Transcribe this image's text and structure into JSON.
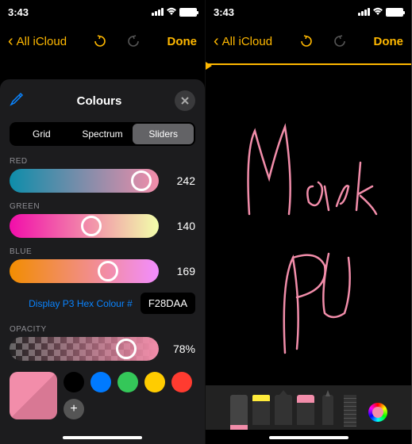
{
  "time": "3:43",
  "nav": {
    "back": "All iCloud",
    "done": "Done"
  },
  "panel": {
    "title": "Colours",
    "tabs": {
      "grid": "Grid",
      "spectrum": "Spectrum",
      "sliders": "Sliders"
    },
    "red_label": "RED",
    "red_value": "242",
    "green_label": "GREEN",
    "green_value": "140",
    "blue_label": "BLUE",
    "blue_value": "169",
    "hex_label": "Display P3 Hex Colour #",
    "hex_value": "F28DAA",
    "opacity_label": "OPACITY",
    "opacity_value": "78%"
  },
  "swatches": [
    "#000000",
    "#007aff",
    "#34c759",
    "#ffcc00",
    "#ff3b30"
  ],
  "colors": {
    "accent": "#ffb800",
    "current": "#f28daa"
  }
}
